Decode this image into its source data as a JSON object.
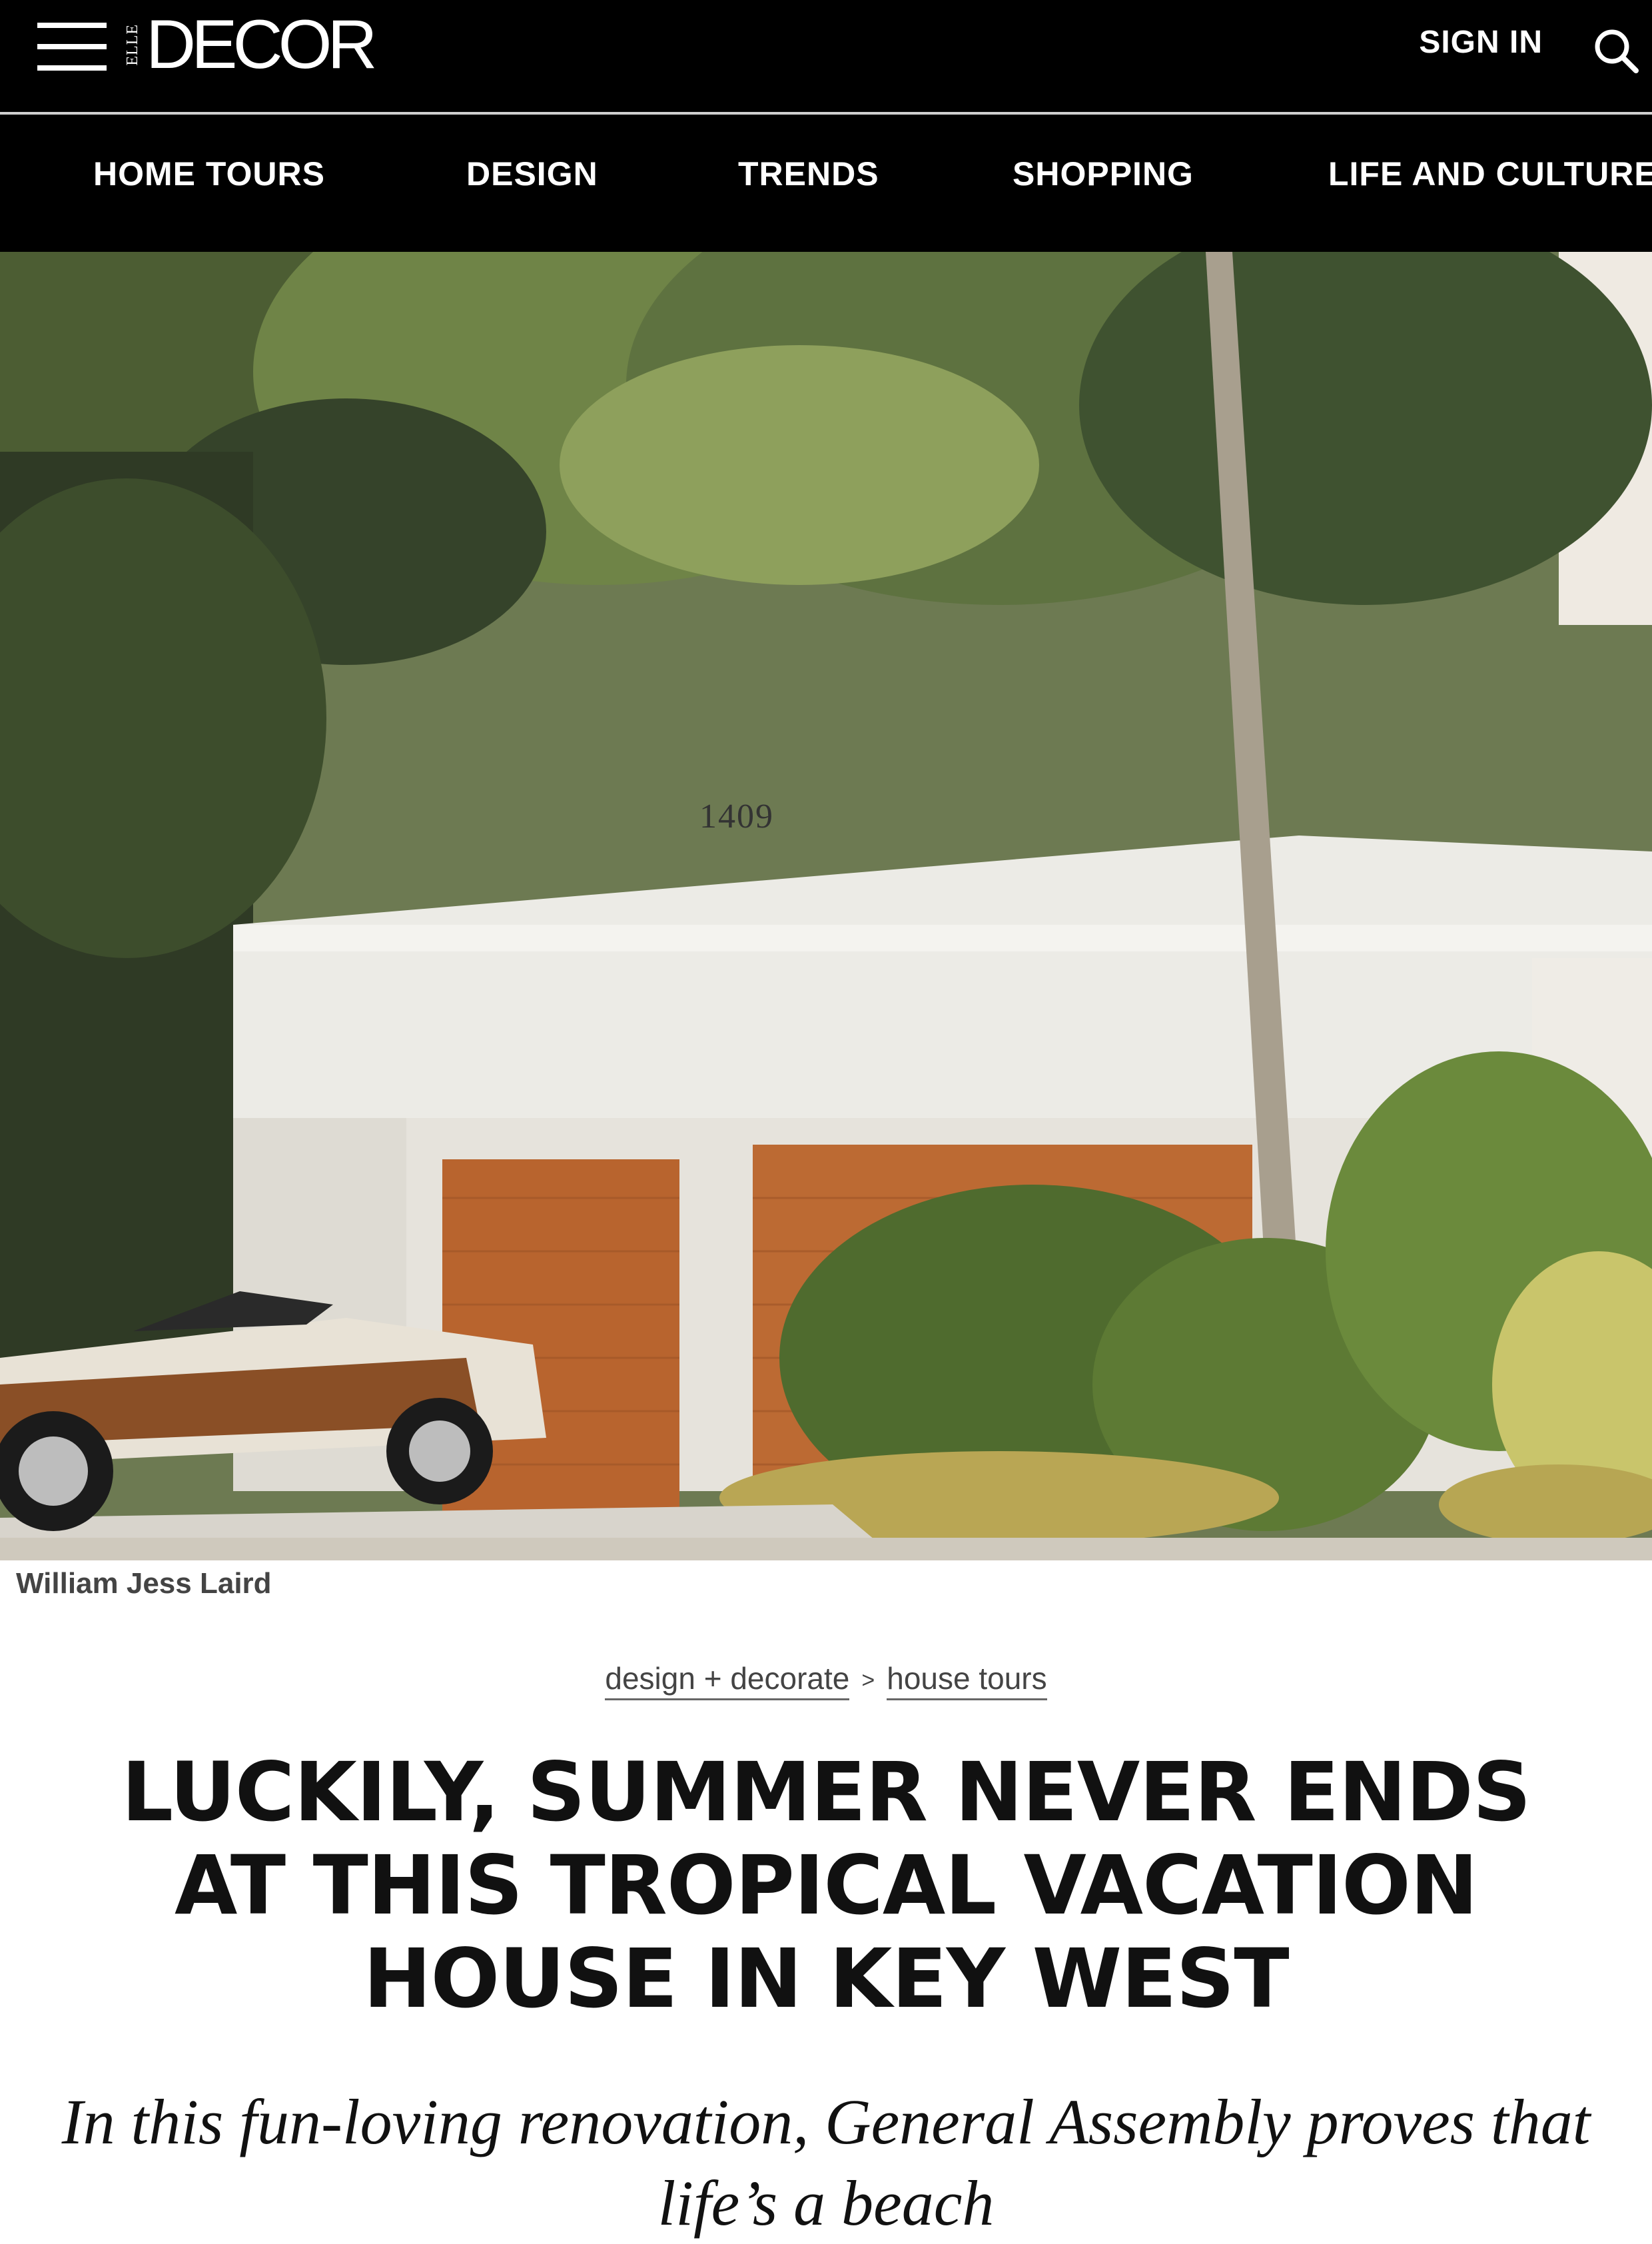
{
  "header": {
    "logo_prefix": "ELLE",
    "logo_main": "DECOR",
    "sign_in": "SIGN IN"
  },
  "nav": {
    "items": [
      {
        "label": "HOME TOURS"
      },
      {
        "label": "DESIGN"
      },
      {
        "label": "TRENDS"
      },
      {
        "label": "SHOPPING"
      },
      {
        "label": "LIFE AND CULTURE"
      }
    ]
  },
  "hero": {
    "house_number": "1409",
    "credit": "William Jess Laird"
  },
  "breadcrumb": {
    "items": [
      "design + decorate",
      "house tours"
    ],
    "separator": ">"
  },
  "article": {
    "headline": "LUCKILY, SUMMER NEVER ENDS AT THIS TROPICAL VACATION HOUSE IN KEY WEST",
    "dek": "In this fun-loving renovation, General Assembly proves that life’s a beach"
  },
  "colors": {
    "header_bg": "#000000",
    "header_text": "#ffffff",
    "garage_wood": "#b8642e"
  }
}
